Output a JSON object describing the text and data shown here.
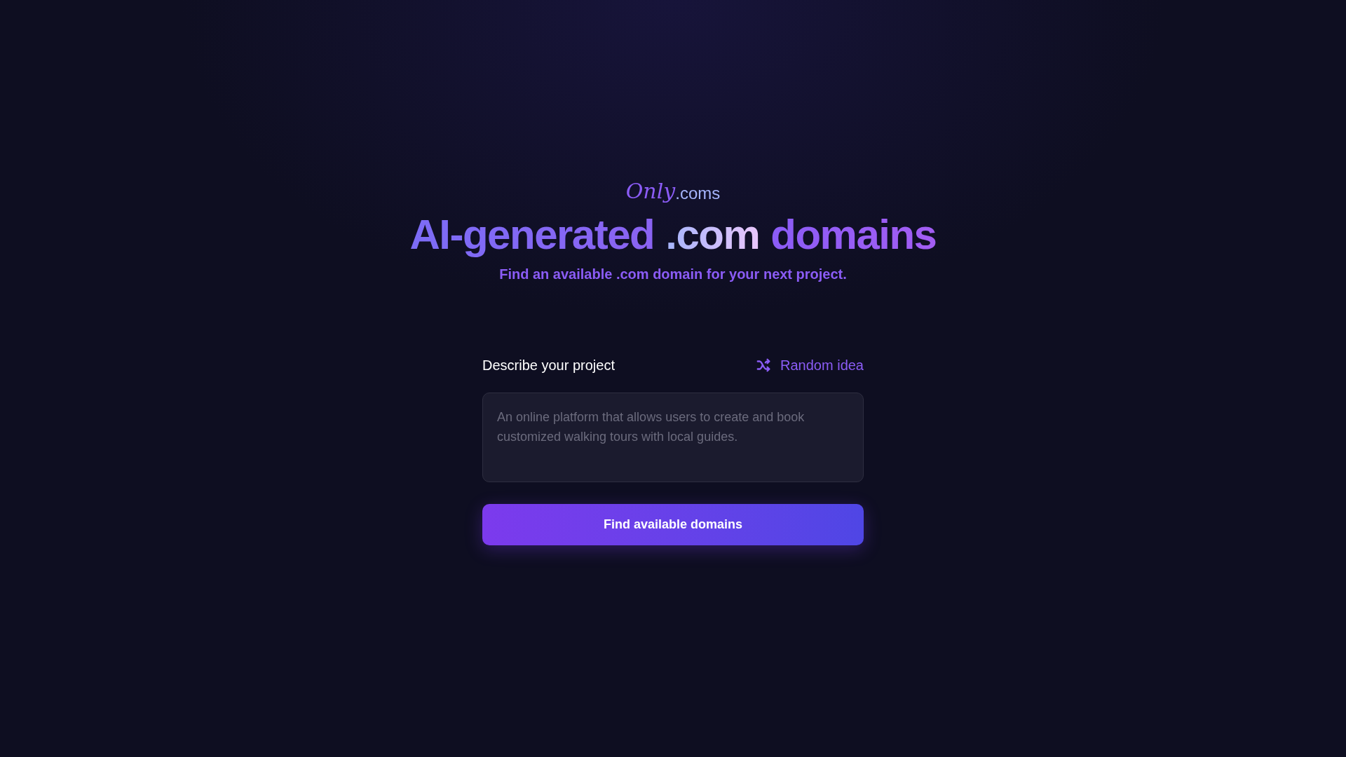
{
  "logo": {
    "script": "Only",
    "suffix": ".coms"
  },
  "heading": [
    {
      "text": "AI-generated",
      "kind": "violet"
    },
    {
      "text": ".com",
      "kind": "glow"
    },
    {
      "text": "domains",
      "kind": "purple"
    }
  ],
  "subtitle": "Find an available .com domain for your next project.",
  "form": {
    "label": "Describe your project",
    "random_button": "Random idea",
    "placeholder": "An online platform that allows users to create and book customized walking tours with local guides.",
    "submit": "Find available domains"
  }
}
